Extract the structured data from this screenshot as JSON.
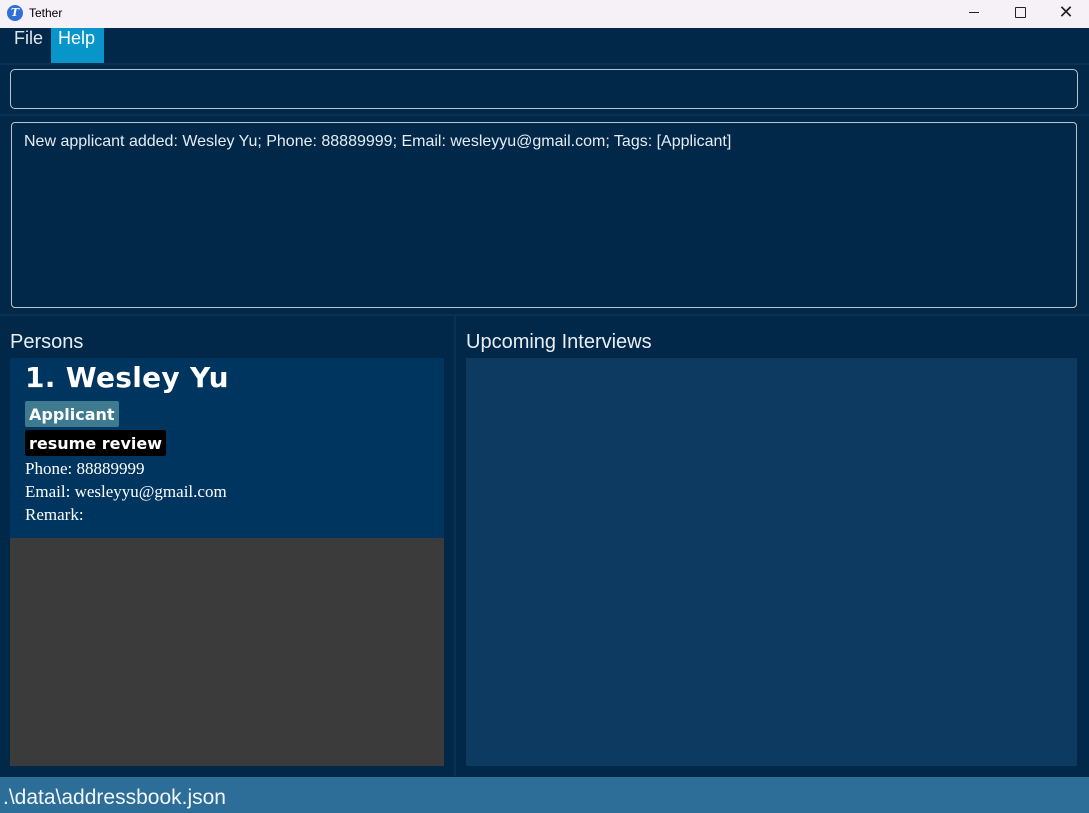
{
  "window": {
    "title": "Tether",
    "icon": "app-logo-icon",
    "icon_letter": "T"
  },
  "menu": {
    "items": [
      "File",
      "Help"
    ],
    "active": "Help"
  },
  "command_box": {
    "value": "",
    "placeholder": ""
  },
  "result": {
    "message": "New applicant added: Wesley Yu; Phone: 88889999; Email: wesleyyu@gmail.com; Tags: [Applicant]"
  },
  "persons_panel": {
    "title": "Persons",
    "persons": [
      {
        "index": "1.",
        "name": "Wesley Yu",
        "tags": [
          "Applicant",
          "resume review"
        ],
        "phone": "Phone: 88889999",
        "email": "Email: wesleyyu@gmail.com",
        "remark": "Remark:"
      }
    ]
  },
  "interviews_panel": {
    "title": "Upcoming Interviews"
  },
  "status_bar": {
    "path": ".\\data\\addressbook.json"
  },
  "colors": {
    "background": "#012849",
    "menu_active": "#0895c9",
    "card": "#003560",
    "tag_applicant": "#3e7b91",
    "tag_resume": "#000000",
    "status_bar": "#2c6e98"
  }
}
